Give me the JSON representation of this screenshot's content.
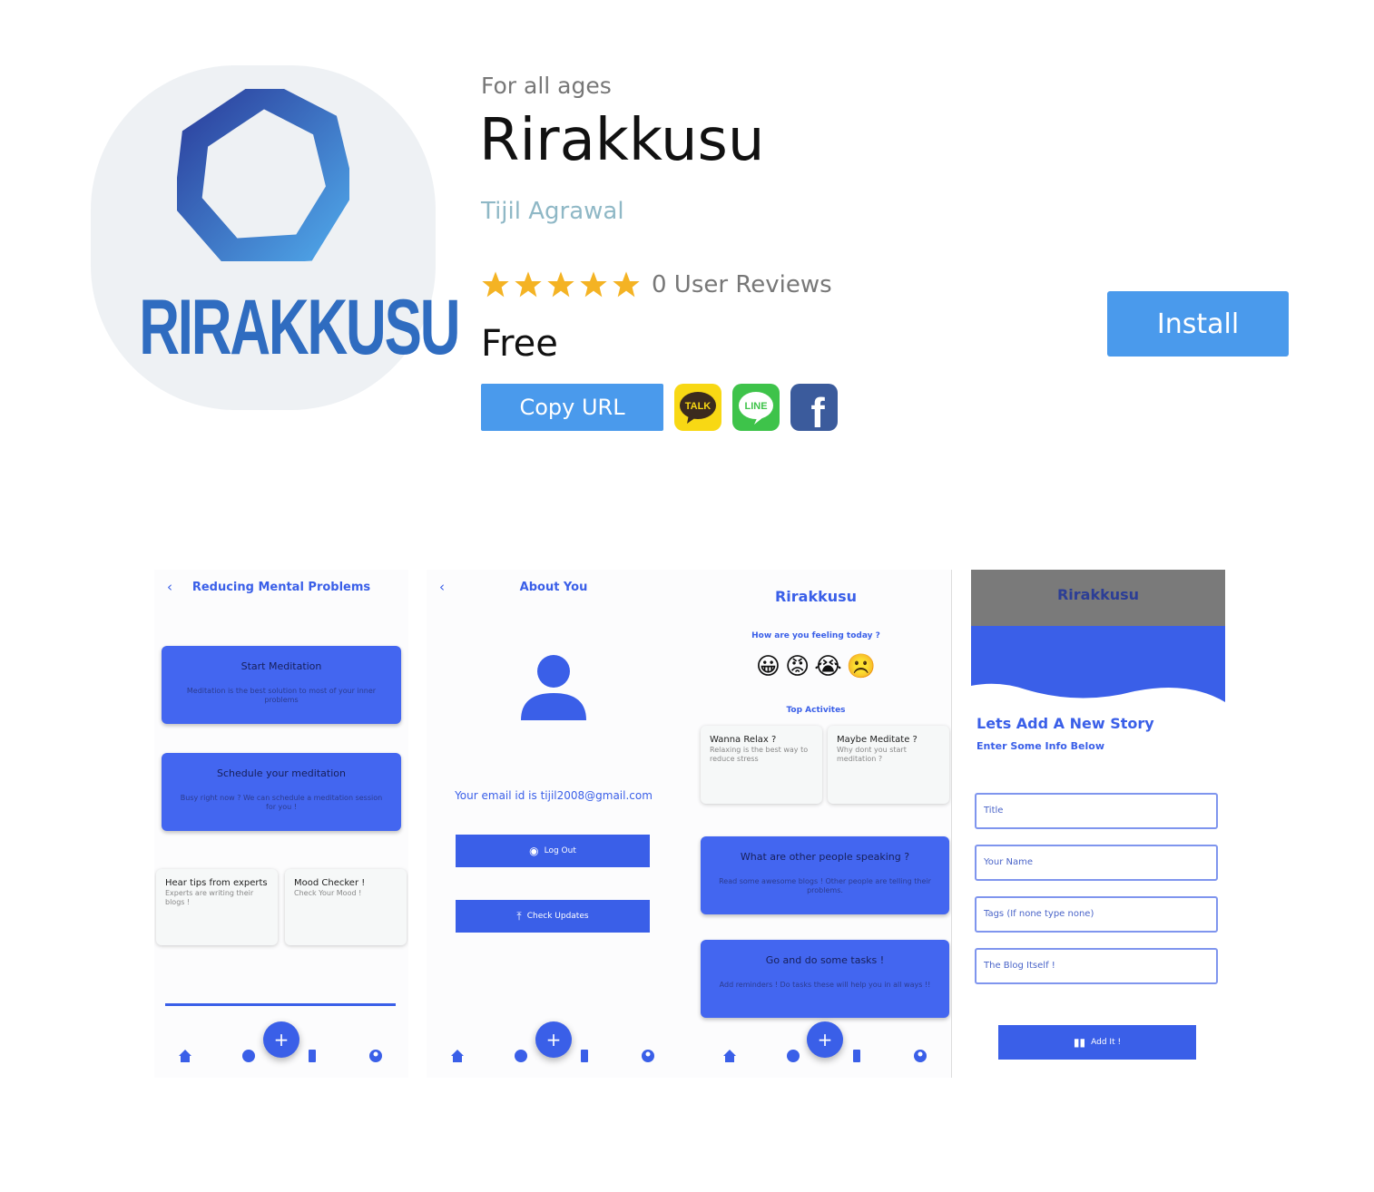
{
  "app": {
    "icon_wordmark": "RIRAKKUSU",
    "age_rating": "For all ages",
    "title": "Rirakkusu",
    "developer": "Tijil Agrawal",
    "rating_stars": 5,
    "reviews": "0 User Reviews",
    "price": "Free",
    "install_label": "Install",
    "copy_url_label": "Copy URL",
    "kakao_label": "TALK",
    "line_label": "LINE",
    "fb_label": "f"
  },
  "colors": {
    "accent": "#4a9aec",
    "star": "#f4b324",
    "app_blue": "#3a5fe8"
  },
  "screens": {
    "s1": {
      "title": "Reducing Mental Problems",
      "card1_title": "Start Meditation",
      "card1_sub": "Meditation is the best solution to most of your inner problems",
      "card2_title": "Schedule your meditation",
      "card2_sub": "Busy right now ? We can schedule a meditation session for you !",
      "mini1_title": "Hear tips from experts",
      "mini1_sub": "Experts are writing their blogs !",
      "mini2_title": "Mood Checker !",
      "mini2_sub": "Check Your Mood !"
    },
    "s2": {
      "title": "About You",
      "email": "Your email id is tijil2008@gmail.com",
      "logout": "Log Out",
      "updates": "Check Updates"
    },
    "s3": {
      "title": "Rirakkusu",
      "question": "How are you feeling today ?",
      "emojis": [
        "😀",
        "😡",
        "😭",
        "☹️"
      ],
      "top": "Top Activites",
      "mini1_title": "Wanna Relax ?",
      "mini1_sub": "Relaxing is the best way to reduce stress",
      "mini2_title": "Maybe Meditate ?",
      "mini2_sub": "Why dont you start meditation ?",
      "card1_title": "What are other people speaking ?",
      "card1_sub": "Read some awesome blogs ! Other people are telling their problems.",
      "card2_title": "Go and do some tasks !",
      "card2_sub": "Add reminders ! Do tasks these will help you in all ways !!"
    },
    "s4": {
      "title": "Rirakkusu",
      "heading": "Lets Add A New Story",
      "sub": "Enter Some Info Below",
      "f1": "Title",
      "f2": "Your Name",
      "f3": "Tags (If none type none)",
      "f4": "The Blog Itself !",
      "add": "Add It !"
    }
  }
}
